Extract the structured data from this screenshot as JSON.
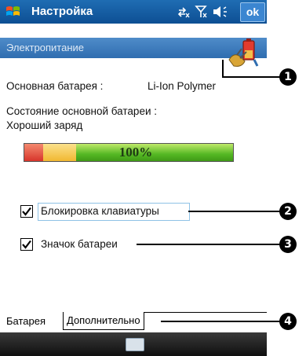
{
  "titlebar": {
    "title": "Настройка",
    "ok_label": "ok"
  },
  "header": {
    "title": "Электропитание"
  },
  "main": {
    "main_battery_label": "Основная батарея :",
    "main_battery_type": "Li-Ion Polymer",
    "status_label": "Состояние основной батареи :",
    "status_value": "Хороший заряд",
    "battery_percent": "100%",
    "battery_level": 1.0,
    "options": [
      {
        "label": "Блокировка клавиатуры",
        "checked": true
      },
      {
        "label": "Значок батареи",
        "checked": true
      }
    ]
  },
  "tabs": [
    {
      "label": "Батарея",
      "active": true
    },
    {
      "label": "Дополнительно",
      "active": false
    }
  ],
  "callouts": [
    "1",
    "2",
    "3",
    "4"
  ],
  "colors": {
    "titlebar": "#0d4f93",
    "accent": "#2f6db0",
    "battery_red": "#d7352b",
    "battery_yellow": "#f1b832",
    "battery_green": "#55b824"
  },
  "icons": {
    "start": "windows-flag-icon",
    "status": [
      "connectivity-icon",
      "signal-off-icon",
      "volume-icon"
    ],
    "power": "battery-power-icon",
    "keyboard": "keyboard-icon"
  }
}
